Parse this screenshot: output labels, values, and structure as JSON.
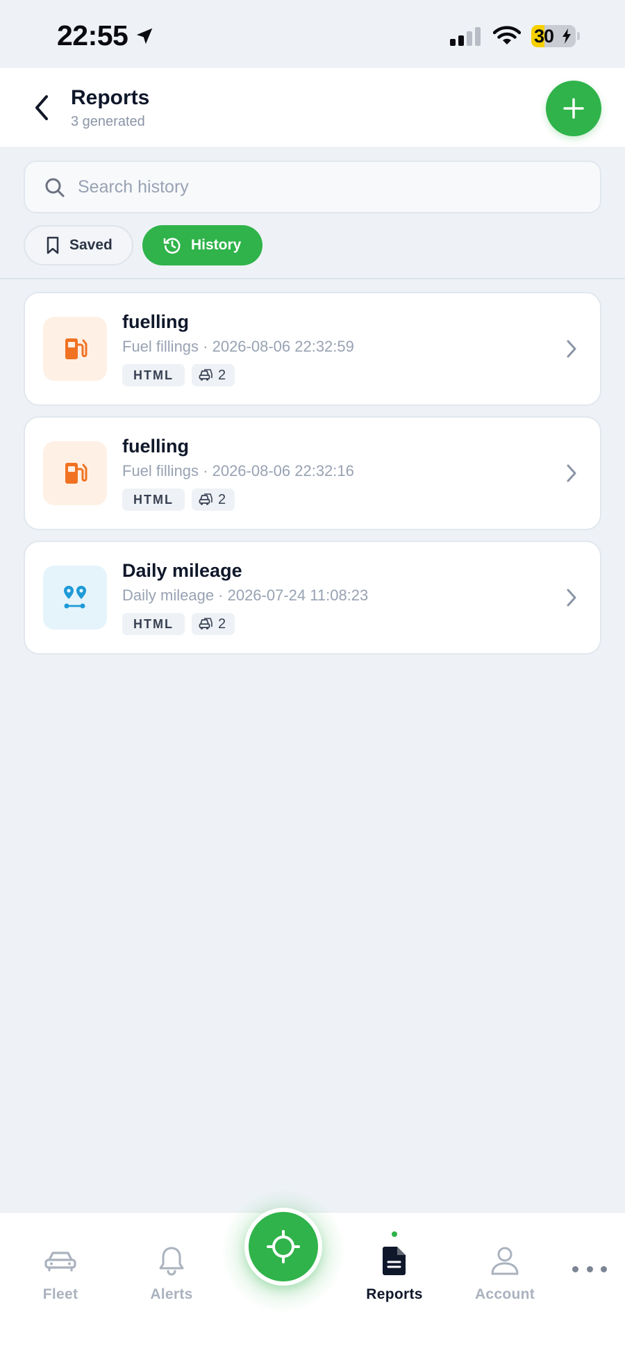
{
  "status_bar": {
    "time": "22:55",
    "battery": "30",
    "battery_level": 0.3
  },
  "header": {
    "title": "Reports",
    "subtitle": "3 generated"
  },
  "search": {
    "placeholder": "Search history",
    "value": ""
  },
  "tabs": [
    {
      "label": "Saved",
      "active": false
    },
    {
      "label": "History",
      "active": true
    }
  ],
  "reports": [
    {
      "name": "fuelling",
      "meta": "Fuel fillings · 2026-08-06 22:32:59",
      "format": "HTML",
      "vehicles": "2",
      "icon": "fuel-pump-icon"
    },
    {
      "name": "fuelling",
      "meta": "Fuel fillings · 2026-08-06 22:32:16",
      "format": "HTML",
      "vehicles": "2",
      "icon": "fuel-pump-icon"
    },
    {
      "name": "Daily mileage",
      "meta": "Daily mileage · 2026-07-24 11:08:23",
      "format": "HTML",
      "vehicles": "2",
      "icon": "route-icon"
    }
  ],
  "bottom_nav": {
    "items": [
      {
        "label": "Fleet",
        "icon": "car-icon",
        "active": false
      },
      {
        "label": "Alerts",
        "icon": "bell-icon",
        "active": false
      },
      {
        "label": "Reports",
        "icon": "document-icon",
        "active": true
      },
      {
        "label": "Account",
        "icon": "user-icon",
        "active": false
      }
    ],
    "center_icon": "crosshair-icon",
    "more_icon": "more-icon"
  },
  "colors": {
    "accent": "#2fb34a",
    "fuel_icon": "#f07222",
    "fuel_bg": "#fff0e5",
    "mileage_icon": "#1d9ad6",
    "mileage_bg": "#e5f4fb",
    "background": "#eef2f6"
  }
}
